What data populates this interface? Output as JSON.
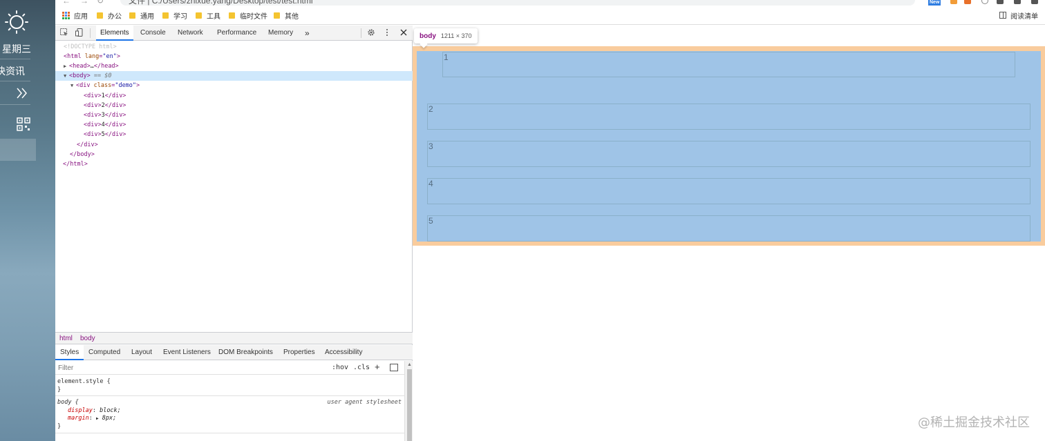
{
  "desktop": {
    "weekday": "星期三",
    "news": "快资讯"
  },
  "browser": {
    "address_text": "文件 | C:/Users/zhixue.yang/Desktop/test/test.html",
    "new_badge": "New",
    "bookmarks": [
      {
        "label": "应用",
        "icon": "apps-grid-icon"
      },
      {
        "label": "办公",
        "icon": "folder-icon"
      },
      {
        "label": "通用",
        "icon": "folder-icon"
      },
      {
        "label": "学习",
        "icon": "folder-icon"
      },
      {
        "label": "工具",
        "icon": "folder-icon"
      },
      {
        "label": "临时文件",
        "icon": "folder-icon"
      },
      {
        "label": "其他",
        "icon": "folder-icon"
      }
    ],
    "reading_list": "阅读清单"
  },
  "devtools": {
    "tabs": [
      "Elements",
      "Console",
      "Network",
      "Performance",
      "Memory"
    ],
    "active_tab": "Elements",
    "more_tabs": "»",
    "dom": {
      "doctype": "<!DOCTYPE html>",
      "html_tag": "html",
      "html_attr": "lang",
      "html_val": "\"en\"",
      "head_open": "<head>",
      "head_ellipsis": "…",
      "head_close": "</head>",
      "body_tag": "<body>",
      "body_ref": "== $0",
      "div_tag": "div",
      "div_attr": "class",
      "div_val": "\"demo\"",
      "children": [
        "1",
        "2",
        "3",
        "4",
        "5"
      ],
      "div_close": "</div>",
      "body_close": "</body>",
      "html_close": "</html>"
    },
    "breadcrumbs": [
      "html",
      "body"
    ],
    "style_tabs": [
      "Styles",
      "Computed",
      "Layout",
      "Event Listeners",
      "DOM Breakpoints",
      "Properties",
      "Accessibility"
    ],
    "active_style_tab": "Styles",
    "filter_placeholder": "Filter",
    "hov": ":hov",
    "cls": ".cls",
    "plus": "+",
    "rules": {
      "element_style": "element.style {",
      "close_brace": "}",
      "body_selector": "body {",
      "ua_source": "user agent stylesheet",
      "display_prop": "display",
      "display_val": "block;",
      "margin_prop": "margin",
      "margin_val": "8px;"
    }
  },
  "page": {
    "tooltip_tag": "body",
    "tooltip_size": "1211 × 370",
    "divs": [
      "1",
      "2",
      "3",
      "4",
      "5"
    ]
  },
  "watermark": "@稀土掘金技术社区",
  "colors": {
    "margin_highlight": "#f9cc9d",
    "content_highlight": "#9fc4e7",
    "tag_color": "#881280",
    "attr_color": "#994500",
    "value_color": "#1a1aa6",
    "selected_row": "#cfe8fc",
    "active_tab_underline": "#1a73e8"
  }
}
